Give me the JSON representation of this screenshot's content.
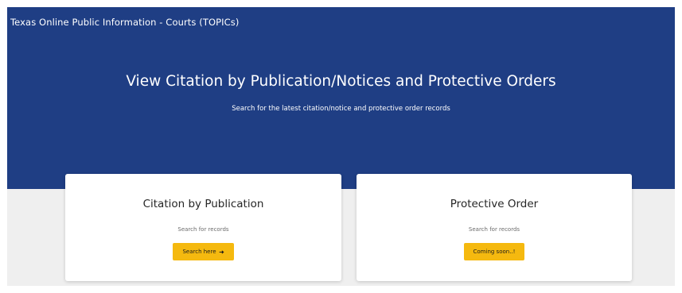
{
  "header": {
    "brand": "Texas Online Public Information - Courts (TOPICs)"
  },
  "hero": {
    "title": "View Citation by Publication/Notices and Protective Orders",
    "subtitle": "Search for the latest citation/notice and protective order records"
  },
  "cards": [
    {
      "title": "Citation by Publication",
      "subtitle": "Search for records",
      "button_label": "Search here",
      "button_icon": "arrow-right-icon"
    },
    {
      "title": "Protective Order",
      "subtitle": "Search for records",
      "button_label": "Coming soon..!"
    }
  ],
  "colors": {
    "hero_background": "#1f3e84",
    "page_band": "#efefef",
    "button_accent": "#f5b90f"
  }
}
